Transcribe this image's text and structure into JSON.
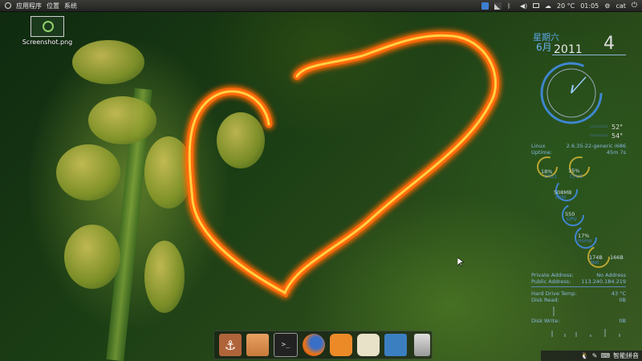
{
  "panel": {
    "menu": [
      "应用程序",
      "位置",
      "系统"
    ],
    "weather": "20 °C",
    "time": "01:05",
    "user": "cat"
  },
  "desktop_icon": {
    "label": "Screenshot.png"
  },
  "conky": {
    "day": "星期六",
    "month": "6月",
    "year": "2011",
    "date": "4",
    "temp_a": "52°",
    "temp_b": "54°",
    "os_label": "Linux",
    "kernel": "2.6.35-22-generic i686",
    "uptime_label": "Uptime:",
    "uptime": "45m 7s",
    "cpu1": "18%",
    "cpu1_label": "CPU1",
    "cpu2": "15%",
    "cpu2_label": "CPU2",
    "ram": "508MB",
    "ram_label": "RAM",
    "gpu": "550",
    "gpu_label": "GPU",
    "home": "17%",
    "home_label": "Home",
    "disk_a": "174B",
    "disk_b": "166B",
    "net_label": "Net",
    "private_label": "Private Address:",
    "private_value": "No Address",
    "public_label": "Public Address:",
    "public_value": "113.240.184.219",
    "hdd_temp_label": "Hard Drive Temp:",
    "hdd_temp_value": "43 °C",
    "disk_read_label": "Disk Read:",
    "disk_read_value": "0B",
    "disk_write_label": "Disk Write:",
    "disk_write_value": "0B"
  },
  "dock": {
    "apps": [
      "anchor-icon",
      "folder-icon",
      "terminal-icon",
      "firefox-icon",
      "pidgin-icon",
      "webcam-icon",
      "brain-icon",
      "trash-icon"
    ]
  },
  "bottom_tray": {
    "label": "智能拼音"
  }
}
